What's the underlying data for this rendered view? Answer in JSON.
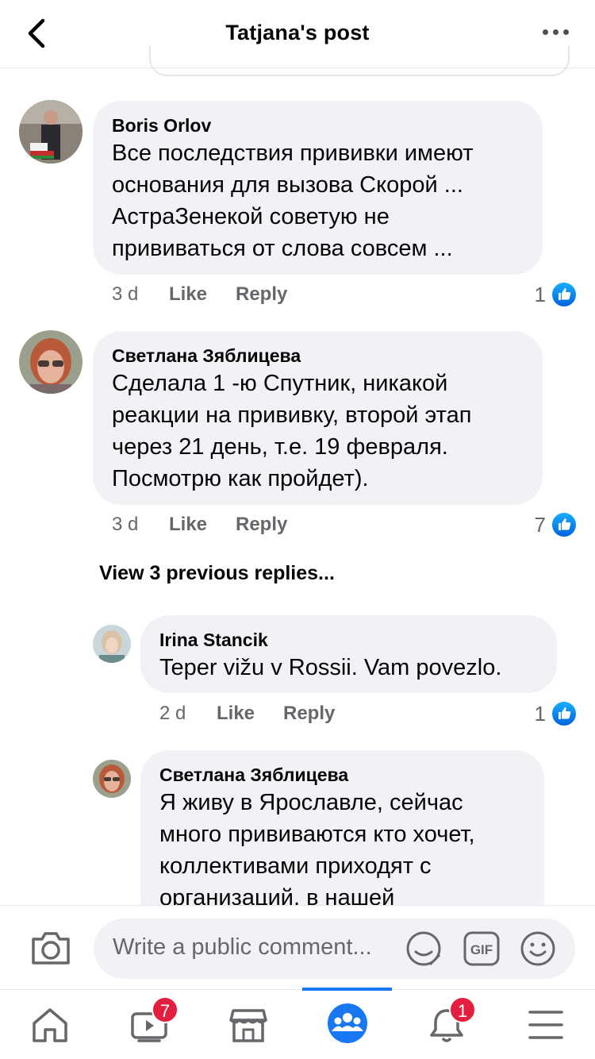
{
  "header": {
    "title": "Tatjana's post"
  },
  "comments": [
    {
      "author": "Boris Orlov",
      "text": "Все последствия прививки имеют основания для вызова Скорой ... АстраЗенекой советую не прививаться от слова совсем ...",
      "time": "3 d",
      "like_label": "Like",
      "reply_label": "Reply",
      "reactions": "1"
    },
    {
      "author": "Светлана Зяблицева",
      "text": "Сделала 1 -ю Спутник, никакой реакции на прививку, второй этап через 21 день, т.е. 19 февраля. Посмотрю как пройдет).",
      "time": "3 d",
      "like_label": "Like",
      "reply_label": "Reply",
      "reactions": "7"
    }
  ],
  "view_previous": "View 3 previous replies...",
  "replies": [
    {
      "author": "Irina  Stancik",
      "text": "Teper vižu v Rossii. Vam povezlo.",
      "time": "2 d",
      "like_label": "Like",
      "reply_label": "Reply",
      "reactions": "1"
    },
    {
      "author": "Светлана Зяблицева",
      "text": "Я живу в Ярославле, сейчас много прививаются кто хочет, коллективами приходят с организаций, в нашей"
    }
  ],
  "composer": {
    "placeholder": "Write a public comment..."
  },
  "nav": {
    "items": [
      "home-icon",
      "watch-icon",
      "marketplace-icon",
      "groups-icon",
      "notifications-icon",
      "menu-icon"
    ],
    "watch_badge": "7",
    "notifications_badge": "1"
  },
  "colors": {
    "accent": "#1877f2",
    "bubble": "#f0f2f5",
    "badge": "#e41e3f"
  }
}
